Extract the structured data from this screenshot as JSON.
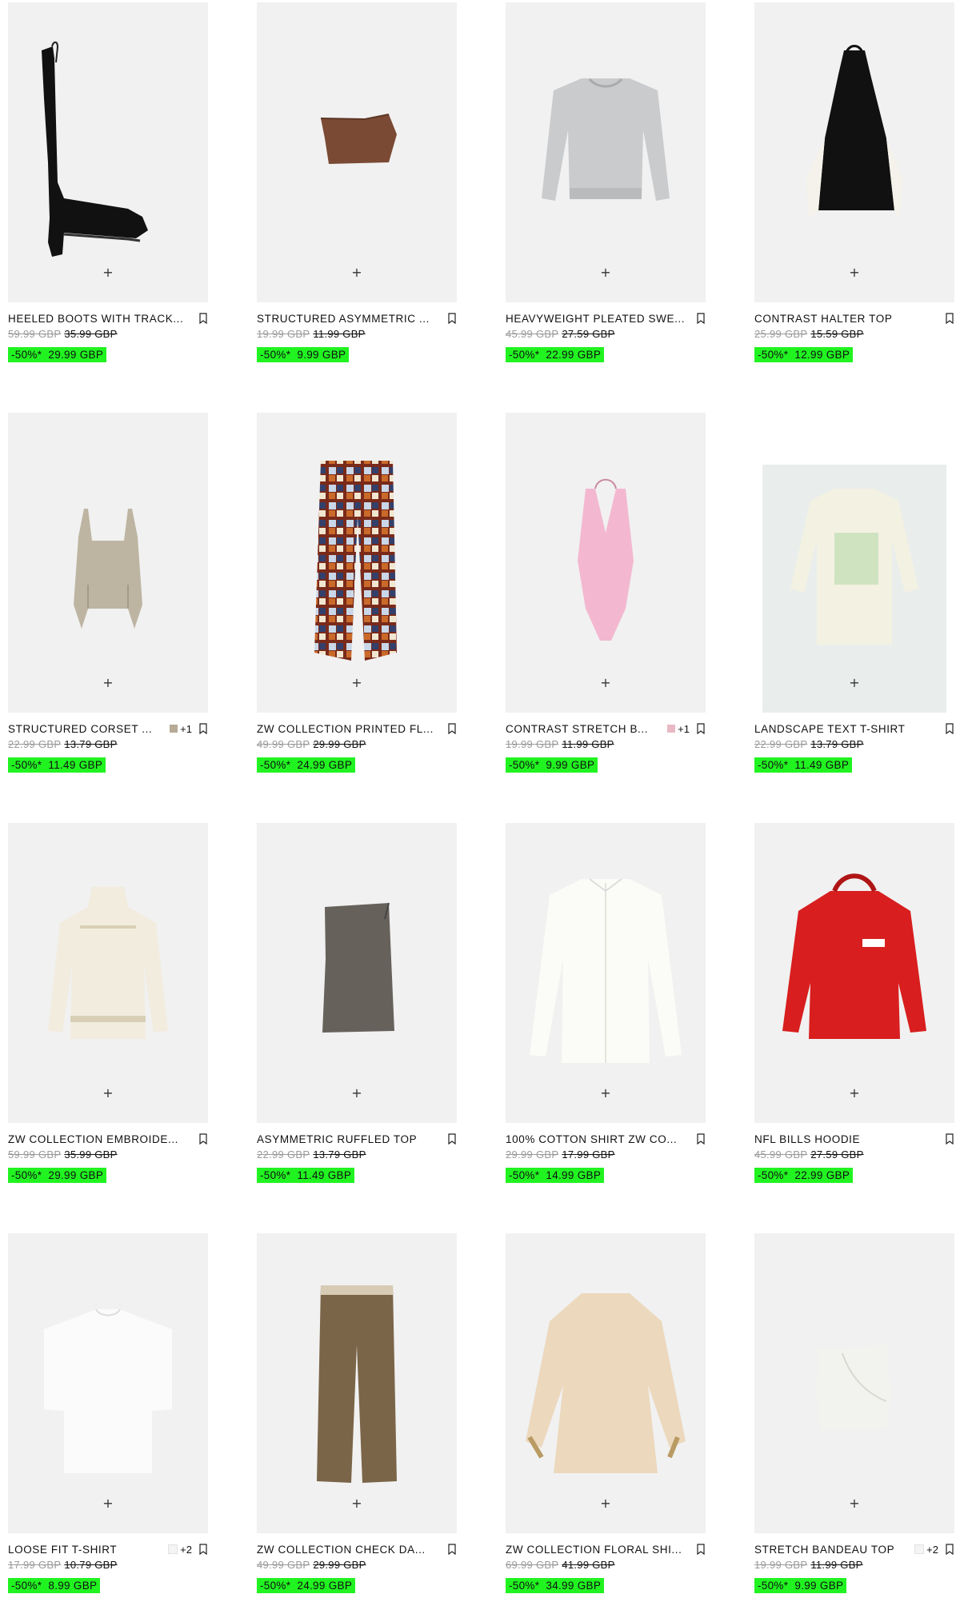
{
  "colors": {
    "sale_highlight": "#21f321",
    "image_bg": "#f1f1f1"
  },
  "icons": {
    "add": "plus-icon",
    "bookmark": "bookmark-icon"
  },
  "plus_symbol": "+",
  "products": [
    {
      "name": "HEELED BOOTS WITH TRACK...",
      "original_price": "59.99 GBP",
      "previous_price": "35.99 GBP",
      "discount": "-50%*",
      "sale_price": "29.99 GBP",
      "extra_colors": "",
      "swatch_color": ""
    },
    {
      "name": "STRUCTURED ASYMMETRIC ...",
      "original_price": "19.99 GBP",
      "previous_price": "11.99 GBP",
      "discount": "-50%*",
      "sale_price": "9.99 GBP",
      "extra_colors": "",
      "swatch_color": ""
    },
    {
      "name": "HEAVYWEIGHT PLEATED SWE...",
      "original_price": "45.99 GBP",
      "previous_price": "27.59 GBP",
      "discount": "-50%*",
      "sale_price": "22.99 GBP",
      "extra_colors": "",
      "swatch_color": ""
    },
    {
      "name": "CONTRAST HALTER TOP",
      "original_price": "25.99 GBP",
      "previous_price": "15.59 GBP",
      "discount": "-50%*",
      "sale_price": "12.99 GBP",
      "extra_colors": "",
      "swatch_color": ""
    },
    {
      "name": "STRUCTURED CORSET ...",
      "original_price": "22.99 GBP",
      "previous_price": "13.79 GBP",
      "discount": "-50%*",
      "sale_price": "11.49 GBP",
      "extra_colors": "+1",
      "swatch_color": "#b7ab96"
    },
    {
      "name": "ZW COLLECTION PRINTED FL...",
      "original_price": "49.99 GBP",
      "previous_price": "29.99 GBP",
      "discount": "-50%*",
      "sale_price": "24.99 GBP",
      "extra_colors": "",
      "swatch_color": ""
    },
    {
      "name": "CONTRAST STRETCH B...",
      "original_price": "19.99 GBP",
      "previous_price": "11.99 GBP",
      "discount": "-50%*",
      "sale_price": "9.99 GBP",
      "extra_colors": "+1",
      "swatch_color": "#e8b9c4"
    },
    {
      "name": "LANDSCAPE TEXT T-SHIRT",
      "original_price": "22.99 GBP",
      "previous_price": "13.79 GBP",
      "discount": "-50%*",
      "sale_price": "11.49 GBP",
      "extra_colors": "",
      "swatch_color": ""
    },
    {
      "name": "ZW COLLECTION EMBROIDE...",
      "original_price": "59.99 GBP",
      "previous_price": "35.99 GBP",
      "discount": "-50%*",
      "sale_price": "29.99 GBP",
      "extra_colors": "",
      "swatch_color": ""
    },
    {
      "name": "ASYMMETRIC RUFFLED TOP",
      "original_price": "22.99 GBP",
      "previous_price": "13.79 GBP",
      "discount": "-50%*",
      "sale_price": "11.49 GBP",
      "extra_colors": "",
      "swatch_color": ""
    },
    {
      "name": "100% COTTON SHIRT ZW CO...",
      "original_price": "29.99 GBP",
      "previous_price": "17.99 GBP",
      "discount": "-50%*",
      "sale_price": "14.99 GBP",
      "extra_colors": "",
      "swatch_color": ""
    },
    {
      "name": "NFL BILLS HOODIE",
      "original_price": "45.99 GBP",
      "previous_price": "27.59 GBP",
      "discount": "-50%*",
      "sale_price": "22.99 GBP",
      "extra_colors": "",
      "swatch_color": ""
    },
    {
      "name": "LOOSE FIT T-SHIRT",
      "original_price": "17.99 GBP",
      "previous_price": "10.79 GBP",
      "discount": "-50%*",
      "sale_price": "8.99 GBP",
      "extra_colors": "+2",
      "swatch_color": "#f4f4f4"
    },
    {
      "name": "ZW COLLECTION CHECK DA...",
      "original_price": "49.99 GBP",
      "previous_price": "29.99 GBP",
      "discount": "-50%*",
      "sale_price": "24.99 GBP",
      "extra_colors": "",
      "swatch_color": ""
    },
    {
      "name": "ZW COLLECTION FLORAL SHI...",
      "original_price": "69.99 GBP",
      "previous_price": "41.99 GBP",
      "discount": "-50%*",
      "sale_price": "34.99 GBP",
      "extra_colors": "",
      "swatch_color": ""
    },
    {
      "name": "STRETCH BANDEAU TOP",
      "original_price": "19.99 GBP",
      "previous_price": "11.99 GBP",
      "discount": "-50%*",
      "sale_price": "9.99 GBP",
      "extra_colors": "+2",
      "swatch_color": "#f4f4f4"
    }
  ],
  "product_art": [
    "boots-image",
    "brown-top-image",
    "grey-sweatshirt-image",
    "halter-top-image",
    "corset-image",
    "printed-trousers-image",
    "pink-bodysuit-image",
    "landscape-tshirt-image",
    "embroidered-top-image",
    "ruffled-top-image",
    "cotton-shirt-image",
    "bills-hoodie-image",
    "white-tshirt-image",
    "check-trousers-image",
    "floral-shirt-image",
    "bandeau-top-image"
  ]
}
